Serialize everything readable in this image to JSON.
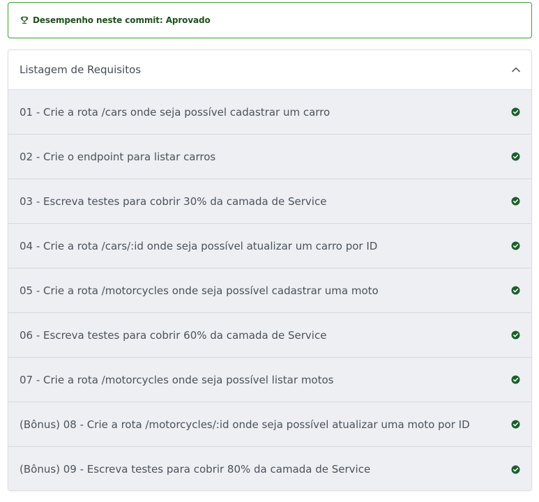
{
  "banner": {
    "icon": "trophy-icon",
    "text": "Desempenho neste commit: Aprovado",
    "border_color": "#3f9b3a",
    "text_color": "#1f4f1c"
  },
  "requirements": {
    "title": "Listagem de Requisitos",
    "toggle_icon": "chevron-up-icon",
    "status_icon": "check-circle-icon",
    "status_color": "#1c5e2c",
    "items": [
      {
        "label": "01 - Crie a rota /cars onde seja possível cadastrar um carro"
      },
      {
        "label": "02 - Crie o endpoint para listar carros"
      },
      {
        "label": "03 - Escreva testes para cobrir 30% da camada de Service"
      },
      {
        "label": "04 - Crie a rota /cars/:id onde seja possível atualizar um carro por ID"
      },
      {
        "label": "05 - Crie a rota /motorcycles onde seja possível cadastrar uma moto"
      },
      {
        "label": "06 - Escreva testes para cobrir 60% da camada de Service"
      },
      {
        "label": "07 - Crie a rota /motorcycles onde seja possível listar motos"
      },
      {
        "label": "(Bônus) 08 - Crie a rota /motorcycles/:id onde seja possível atualizar uma moto por ID"
      },
      {
        "label": "(Bônus) 09 - Escreva testes para cobrir 80% da camada de Service"
      }
    ]
  }
}
